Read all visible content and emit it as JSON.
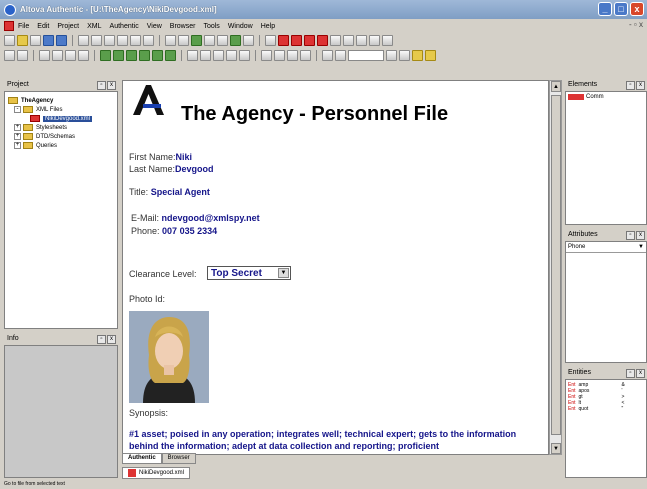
{
  "window": {
    "title": "Altova Authentic - [U:\\TheAgency\\NikiDevgood.xml]"
  },
  "menu": [
    "File",
    "Edit",
    "Project",
    "XML",
    "Authentic",
    "View",
    "Browser",
    "Tools",
    "Window",
    "Help"
  ],
  "project_panel": {
    "title": "Project",
    "root": "TheAgency",
    "items": [
      "XML Files",
      "NikiDevgood.xml",
      "Stylesheets",
      "DTD/Schemas",
      "Queries"
    ]
  },
  "info_panel": {
    "title": "Info"
  },
  "document": {
    "heading": "The Agency - Personnel File",
    "first_name_label": "First Name:",
    "first_name": "Niki",
    "last_name_label": "Last Name:",
    "last_name": "Devgood",
    "title_label": "Title:",
    "title": "Special Agent",
    "email_label": "E-Mail:",
    "email": "ndevgood@xmlspy.net",
    "phone_label": "Phone:",
    "phone": "007 035 2334",
    "clearance_label": "Clearance Level:",
    "clearance": "Top Secret",
    "photo_label": "Photo Id:",
    "synopsis_label": "Synopsis:",
    "synopsis": "#1 asset; poised in any operation; integrates well; technical expert; gets to the information behind the information; adept at data collection and reporting; proficient"
  },
  "view_tabs": [
    "Authentic",
    "Browser"
  ],
  "document_tab": "NikiDevgood.xml",
  "elements_panel": {
    "title": "Elements",
    "items": [
      "Comm"
    ]
  },
  "attributes_panel": {
    "title": "Attributes",
    "selected": "Phone"
  },
  "entities_panel": {
    "title": "Entities",
    "items": [
      {
        "type": "Ent",
        "name": "amp",
        "value": "&"
      },
      {
        "type": "Ent",
        "name": "apos",
        "value": "'"
      },
      {
        "type": "Ent",
        "name": "gt",
        "value": ">"
      },
      {
        "type": "Ent",
        "name": "lt",
        "value": "<"
      },
      {
        "type": "Ent",
        "name": "quot",
        "value": "\""
      }
    ]
  },
  "status": {
    "text": "Go to file from selected text"
  },
  "colors": {
    "accent": "#15158a",
    "titlebar": "#7f9ec4"
  }
}
